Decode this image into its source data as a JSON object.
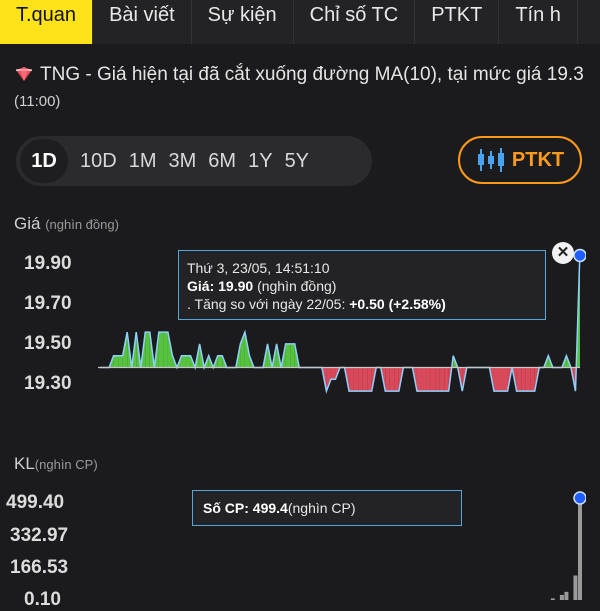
{
  "tabs": [
    {
      "label": "T.quan",
      "active": true
    },
    {
      "label": "Bài viết"
    },
    {
      "label": "Sự kiện"
    },
    {
      "label": "Chỉ số TC"
    },
    {
      "label": "PTKT"
    },
    {
      "label": "Tín h"
    }
  ],
  "alert": {
    "text": "TNG - Giá hiện tại đã cắt xuống đường MA(10), tại mức giá 19.3",
    "time": "(11:00)",
    "icon": "red-diamond-icon"
  },
  "ranges": [
    "1D",
    "10D",
    "1M",
    "3M",
    "6M",
    "1Y",
    "5Y"
  ],
  "selected_range": "1D",
  "ptkt_button": {
    "label": "PTKT",
    "icon": "candlestick-icon"
  },
  "price_panel": {
    "title": "Giá",
    "unit": "(nghìn đồng)",
    "y_ticks": [
      "19.90",
      "19.70",
      "19.50",
      "19.30"
    ]
  },
  "volume_panel": {
    "title": "KL",
    "unit": "(nghìn CP)",
    "y_ticks": [
      "499.40",
      "332.97",
      "166.53",
      "0.10"
    ]
  },
  "price_tooltip": {
    "line1": "Thứ 3, 23/05, 14:51:10",
    "price_label": "Giá:",
    "price_value": "19.90",
    "price_unit": "(nghìn đồng)",
    "change_prefix": ". Tăng so với ngày 22/05:",
    "change_value": "+0.50 (+2.58%)"
  },
  "volume_tooltip": {
    "label": "Số CP:",
    "value": "499.4",
    "unit": "(nghìn CP)"
  },
  "colors": {
    "up_fill": "#56c23f",
    "down_fill": "#d8495a",
    "line": "#8fd0ff",
    "accent": "#ffe31a",
    "ptkt": "#ff9b1a"
  },
  "chart_data": {
    "type": "area",
    "baseline": 19.4,
    "ylim": [
      19.22,
      19.94
    ],
    "price_series": [
      19.4,
      19.4,
      19.4,
      19.45,
      19.45,
      19.45,
      19.55,
      19.4,
      19.55,
      19.4,
      19.55,
      19.55,
      19.4,
      19.55,
      19.55,
      19.55,
      19.45,
      19.4,
      19.45,
      19.45,
      19.45,
      19.4,
      19.5,
      19.4,
      19.45,
      19.4,
      19.45,
      19.45,
      19.4,
      19.4,
      19.4,
      19.5,
      19.55,
      19.45,
      19.4,
      19.4,
      19.4,
      19.5,
      19.4,
      19.5,
      19.4,
      19.5,
      19.5,
      19.5,
      19.4,
      19.4,
      19.4,
      19.4,
      19.4,
      19.4,
      19.3,
      19.35,
      19.35,
      19.4,
      19.4,
      19.3,
      19.3,
      19.3,
      19.3,
      19.3,
      19.3,
      19.4,
      19.4,
      19.3,
      19.3,
      19.3,
      19.3,
      19.4,
      19.4,
      19.4,
      19.3,
      19.3,
      19.3,
      19.3,
      19.3,
      19.3,
      19.3,
      19.3,
      19.45,
      19.4,
      19.3,
      19.4,
      19.4,
      19.4,
      19.4,
      19.4,
      19.4,
      19.3,
      19.3,
      19.3,
      19.3,
      19.4,
      19.3,
      19.3,
      19.3,
      19.3,
      19.3,
      19.4,
      19.4,
      19.45,
      19.4,
      19.4,
      19.4,
      19.45,
      19.4,
      19.3,
      19.9
    ],
    "volume_series": [
      0,
      0,
      0,
      0,
      0,
      0,
      0,
      0,
      0,
      0,
      0,
      0,
      0,
      0,
      0,
      0,
      0,
      0,
      0,
      0,
      0,
      0,
      0,
      0,
      0,
      0,
      0,
      0,
      0,
      0,
      0,
      0,
      0,
      0,
      0,
      0,
      0,
      0,
      0,
      0,
      0,
      0,
      0,
      0,
      0,
      0,
      0,
      0,
      0,
      0,
      0,
      0,
      0,
      0,
      0,
      0,
      0,
      0,
      0,
      0,
      0,
      0,
      0,
      0,
      0,
      0,
      0,
      0,
      0,
      0,
      0,
      0,
      0,
      0,
      0,
      0,
      0,
      0,
      0,
      0,
      0,
      0,
      0,
      0,
      0,
      0,
      0,
      0,
      0,
      0,
      0,
      0,
      0,
      0,
      0,
      0,
      0,
      0,
      0,
      0,
      8,
      0,
      25,
      40,
      0,
      120,
      499.4
    ],
    "volume_ylim": [
      0.1,
      499.4
    ]
  }
}
